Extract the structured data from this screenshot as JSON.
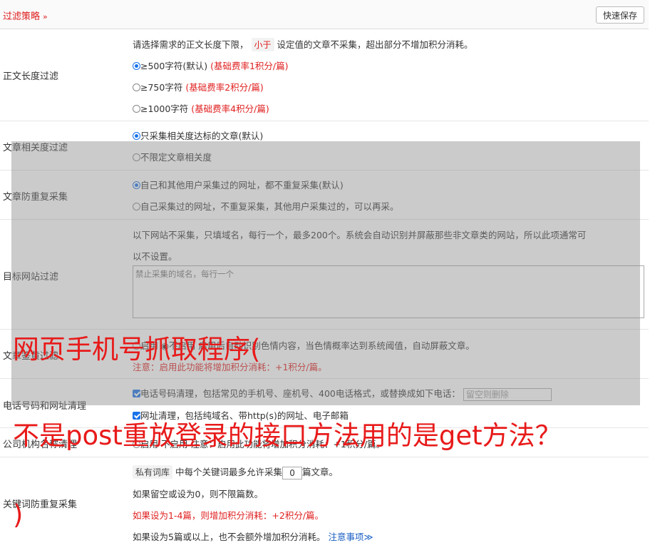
{
  "header": {
    "title": "过滤策略",
    "chevron": "»",
    "save_label": "快速保存"
  },
  "length_filter": {
    "label": "正文长度过滤",
    "desc_pre": "请选择需求的正文长度下限，",
    "desc_tag": "小于",
    "desc_post": "设定值的文章不采集，超出部分不增加积分消耗。",
    "options": [
      {
        "text": "≥500字符(默认)",
        "note": "(基础费率1积分/篇)"
      },
      {
        "text": "≥750字符",
        "note": "(基础费率2积分/篇)"
      },
      {
        "text": "≥1000字符",
        "note": "(基础费率4积分/篇)"
      }
    ]
  },
  "relevance_filter": {
    "label": "文章相关度过滤",
    "options": [
      "只采集相关度达标的文章(默认)",
      "不限定文章相关度"
    ]
  },
  "dedupe": {
    "label": "文章防重复采集",
    "options": [
      "自己和其他用户采集过的网址，都不重复采集(默认)",
      "自己采集过的网址，不重复采集，其他用户采集过的，可以再采。"
    ]
  },
  "site_filter": {
    "label": "目标网站过滤",
    "desc_line1": "以下网站不采集，只填域名，每行一个，最多200个。系统会自动识别并屏蔽那些非文章类的网站，所以此项通常可",
    "desc_line2": "以不设置。",
    "placeholder": "禁止采集的域名，每行一个"
  },
  "porn_filter": {
    "label": "文章鉴黄过滤",
    "line1": "启用  ◉不启用  启用后自动识别色情内容，当色情概率达到系统阈值，自动屏蔽文章。",
    "note": "注意：启用此功能将增加积分消耗：+1积分/篇。"
  },
  "phone_clean": {
    "label": "电话号码和网址清理",
    "line1": "电话号码清理，包括常见的手机号、座机号、400电话格式，或替换成如下电话：",
    "phone_placeholder": "留空则删除",
    "line2": "网址清理，包括纯域名、带http(s)的网址、电子邮箱"
  },
  "org_clean": {
    "label": "公司机构名称清理",
    "line": "启用  不启用  注意：启用此功能将增加积分消耗：+1积分/篇。"
  },
  "keyword_dedupe": {
    "label": "关键词防重复采集",
    "tag": "私有词库",
    "line1_mid": "中每个关键词最多允许采集",
    "count": "0",
    "line1_post": "篇文章。",
    "line2": "如果留空或设为0，则不限篇数。",
    "line3": "如果设为1-4篇，则增加积分消耗：+2积分/篇。",
    "line4": "如果设为5篇或以上，也不会额外增加积分消耗。",
    "notice_link": "注意事项",
    "notice_chevron": "≫"
  },
  "overlay_text": {
    "line1": "网页手机号抓取程序(",
    "line2": "不是post重放登录的接口方法用的是get方法？",
    "line3": ")"
  }
}
